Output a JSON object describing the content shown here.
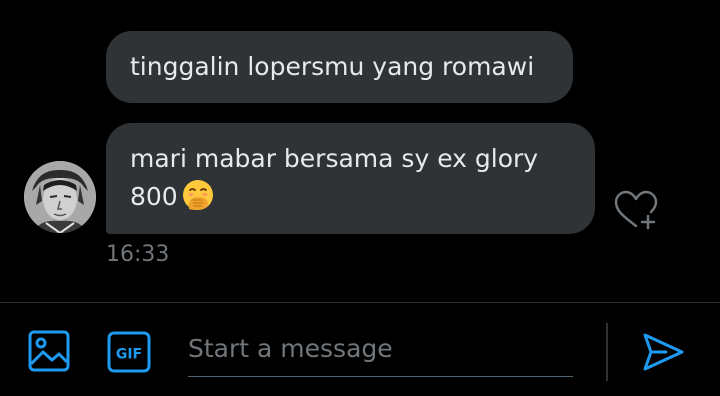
{
  "conversation": {
    "messages": [
      {
        "text": "tinggalin lopersmu yang romawi"
      },
      {
        "text": "mari mabar bersama sy ex glory 800",
        "emoji": "face-with-hand-over-mouth"
      }
    ],
    "timestamp": "16:33"
  },
  "composer": {
    "placeholder": "Start a message",
    "gif_label": "GIF"
  },
  "icons": {
    "media": "image-icon",
    "gif": "gif-icon",
    "send": "send-icon",
    "react": "heart-plus-icon"
  },
  "colors": {
    "background": "#000000",
    "bubble": "#2f3336",
    "text": "#e7e9ea",
    "muted": "#71767b",
    "accent": "#1d9bf0",
    "emoji": "#ffc83d"
  }
}
